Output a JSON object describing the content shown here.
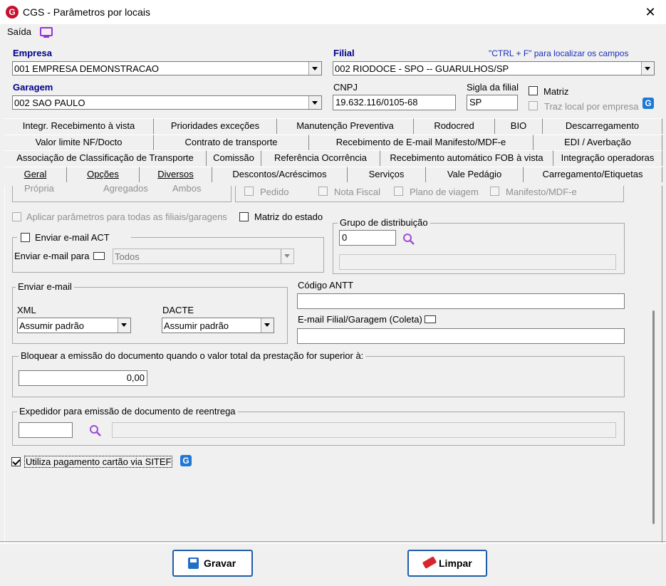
{
  "window": {
    "title": "CGS - Parâmetros por locais",
    "logo": "G"
  },
  "menu": {
    "exit_label": "Saída",
    "exit_icon": "monitor-icon"
  },
  "header": {
    "empresa_label": "Empresa",
    "empresa_value": "001 EMPRESA DEMONSTRACAO",
    "filial_label": "Filial",
    "filial_value": "002 RIODOCE - SPO -- GUARULHOS/SP",
    "ctrl_hint": "\"CTRL + F\" para localizar os campos",
    "garagem_label": "Garagem",
    "garagem_value": "002 SAO PAULO",
    "cnpj_label": "CNPJ",
    "cnpj_value": "19.632.116/0105-68",
    "sigla_label": "Sigla da filial",
    "sigla_value": "SP",
    "matriz_label": "Matriz",
    "traz_local_label": "Traz local por empresa"
  },
  "tabs": {
    "row1": [
      "Integr. Recebimento à vista",
      "Prioridades exceções",
      "Manutenção Preventiva",
      "Rodocred",
      "BIO",
      "Descarregamento"
    ],
    "row2": [
      "Valor limite NF/Docto",
      "Contrato de transporte",
      "Recebimento de E-mail Manifesto/MDF-e",
      "EDI / Averbação"
    ],
    "row3": [
      "Associação de Classificação de Transporte",
      "Comissão",
      "Referência Ocorrência",
      "Recebimento automático FOB à vista",
      "Integração operadoras"
    ],
    "row4": [
      "Geral",
      "Opções",
      "Diversos",
      "Descontos/Acréscimos",
      "Serviços",
      "Vale Pedágio",
      "Carregamento/Etiquetas"
    ],
    "active": "Geral"
  },
  "geral": {
    "radio_propria": "Própria",
    "radio_agregados": "Agregados",
    "radio_ambos": "Ambos",
    "chk_pedido": "Pedido",
    "chk_nota_fiscal": "Nota Fiscal",
    "chk_plano_viagem": "Plano de viagem",
    "chk_manifesto": "Manifesto/MDF-e",
    "aplicar_label": "Aplicar parâmetros para todas as filiais/garagens",
    "matriz_estado_label": "Matriz do estado",
    "enviar_act_label": "Enviar e-mail ACT",
    "enviar_para_label": "Enviar e-mail para",
    "enviar_para_value": "Todos",
    "grupo_title": "Grupo de distribuição",
    "grupo_value": "0",
    "enviar_email_title": "Enviar e-mail",
    "xml_label": "XML",
    "xml_value": "Assumir padrão",
    "dacte_label": "DACTE",
    "dacte_value": "Assumir padrão",
    "antt_label": "Código ANTT",
    "antt_value": "",
    "email_filial_label": "E-mail Filial/Garagem (Coleta)",
    "email_filial_value": "",
    "bloquear_title": "Bloquear a emissão do documento quando o valor total da prestação for superior à:",
    "bloquear_value": "0,00",
    "expedidor_title": "Expedidor para emissão de documento de reentrega",
    "sitef_label": "Utiliza pagamento cartão via SITEF"
  },
  "footer": {
    "gravar_label": "Gravar",
    "limpar_label": "Limpar"
  }
}
